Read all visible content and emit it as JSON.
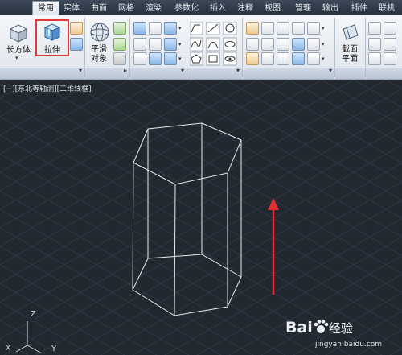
{
  "tabs": [
    {
      "label": "常用",
      "active": true
    },
    {
      "label": "实体"
    },
    {
      "label": "曲面"
    },
    {
      "label": "网格"
    },
    {
      "label": "渲染"
    },
    {
      "label": "参数化"
    },
    {
      "label": "插入"
    },
    {
      "label": "注释"
    },
    {
      "label": "视图"
    },
    {
      "label": "管理"
    },
    {
      "label": "输出"
    },
    {
      "label": "插件"
    },
    {
      "label": "联机"
    }
  ],
  "ribbon": {
    "box_label": "长方体",
    "extrude_label": "拉伸",
    "smooth_label_1": "平滑",
    "smooth_label_2": "对象",
    "section_label_1": "截面",
    "section_label_2": "平面"
  },
  "viewport": {
    "label": "[−][东北等轴测][二维线框]",
    "axis_z": "Z",
    "axis_x": "X",
    "axis_y": "Y",
    "accent_arrow": "#e03030",
    "background": "#212830"
  },
  "watermark": {
    "brand": "Bai",
    "brand2": "du",
    "cn": "经验",
    "url": "jingyan.baidu.com"
  }
}
